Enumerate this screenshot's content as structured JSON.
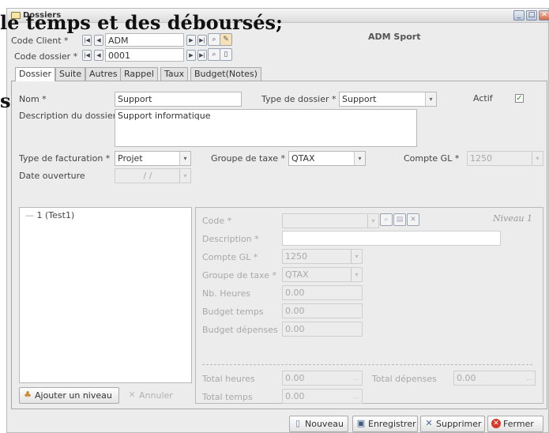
{
  "window": {
    "title": "Dossiers"
  },
  "overlay_text": {
    "line1": "le temps et des déboursés;",
    "line2": "siers;"
  },
  "header": {
    "client_label": "Code Client *",
    "client_value": "ADM",
    "client_name": "ADM Sport",
    "dossier_label": "Code dossier *",
    "dossier_value": "0001"
  },
  "tabs": [
    "Dossier",
    "Suite",
    "Autres",
    "Rappel",
    "Taux",
    "Budget(Notes)"
  ],
  "form": {
    "nom_label": "Nom *",
    "nom_value": "Support",
    "type_dossier_label": "Type de dossier *",
    "type_dossier_value": "Support",
    "actif_label": "Actif",
    "actif_checked": true,
    "description_label": "Description du dossier",
    "description_value": "Support informatique",
    "type_facturation_label": "Type de facturation *",
    "type_facturation_value": "Projet",
    "groupe_taxe_label": "Groupe de taxe *",
    "groupe_taxe_value": "QTAX",
    "compte_gl_label": "Compte GL *",
    "compte_gl_value": "1250",
    "date_ouverture_label": "Date ouverture",
    "date_ouverture_value": "/ /"
  },
  "tree": {
    "items": [
      "1 (Test1)"
    ]
  },
  "niveau": {
    "title": "Niveau 1",
    "code_label": "Code *",
    "description_label": "Description *",
    "compte_gl_label": "Compte GL *",
    "compte_gl_value": "1250",
    "groupe_taxe_label": "Groupe de taxe *",
    "groupe_taxe_value": "QTAX",
    "nb_heures_label": "Nb. Heures",
    "nb_heures_value": "0.00",
    "budget_temps_label": "Budget temps",
    "budget_temps_value": "0.00",
    "budget_depenses_label": "Budget dépenses",
    "budget_depenses_value": "0.00",
    "total_heures_label": "Total heures",
    "total_heures_value": "0.00",
    "total_depenses_label": "Total dépenses",
    "total_depenses_value": "0.00",
    "total_temps_label": "Total temps",
    "total_temps_value": "0.00"
  },
  "buttons": {
    "ajouter_niveau": "Ajouter un niveau",
    "annuler": "Annuler",
    "nouveau": "Nouveau",
    "enregistrer": "Enregistrer",
    "supprimer": "Supprimer",
    "fermer": "Fermer"
  },
  "colors": {
    "accent": "#3a8a2a",
    "danger": "#d43a2a",
    "window_bg": "#ececec"
  }
}
